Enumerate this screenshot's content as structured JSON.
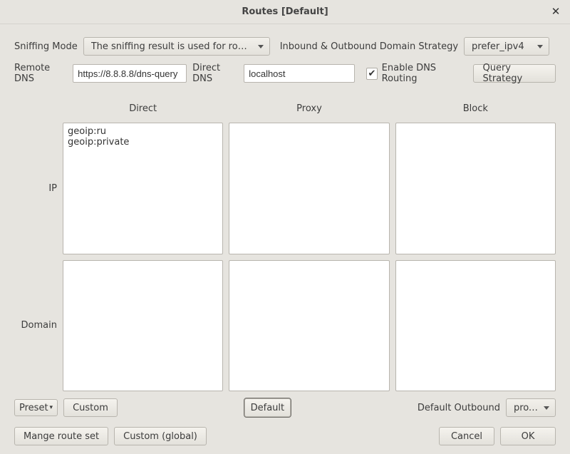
{
  "title": "Routes [Default]",
  "row1": {
    "sniffing_label": "Sniffing Mode",
    "sniffing_value": "The sniffing result is used for routing",
    "domain_strategy_label": "Inbound & Outbound Domain Strategy",
    "domain_strategy_value": "prefer_ipv4"
  },
  "row2": {
    "remote_dns_label": "Remote DNS",
    "remote_dns_value": "https://8.8.8.8/dns-query",
    "direct_dns_label": "Direct DNS",
    "direct_dns_value": "localhost",
    "enable_dns_routing_label": "Enable DNS Routing",
    "enable_dns_routing_checked": true,
    "query_strategy_label": "Query Strategy"
  },
  "grid": {
    "col_direct": "Direct",
    "col_proxy": "Proxy",
    "col_block": "Block",
    "row_ip": "IP",
    "row_domain": "Domain",
    "ip_direct": "geoip:ru\ngeoip:private",
    "ip_proxy": "",
    "ip_block": "",
    "domain_direct": "",
    "domain_proxy": "",
    "domain_block": ""
  },
  "bottom": {
    "preset_label": "Preset",
    "custom_label": "Custom",
    "default_label": "Default",
    "default_outbound_label": "Default Outbound",
    "default_outbound_value": "proxy"
  },
  "actions": {
    "manage_label": "Mange route set",
    "custom_global_label": "Custom (global)",
    "cancel_label": "Cancel",
    "ok_label": "OK"
  }
}
